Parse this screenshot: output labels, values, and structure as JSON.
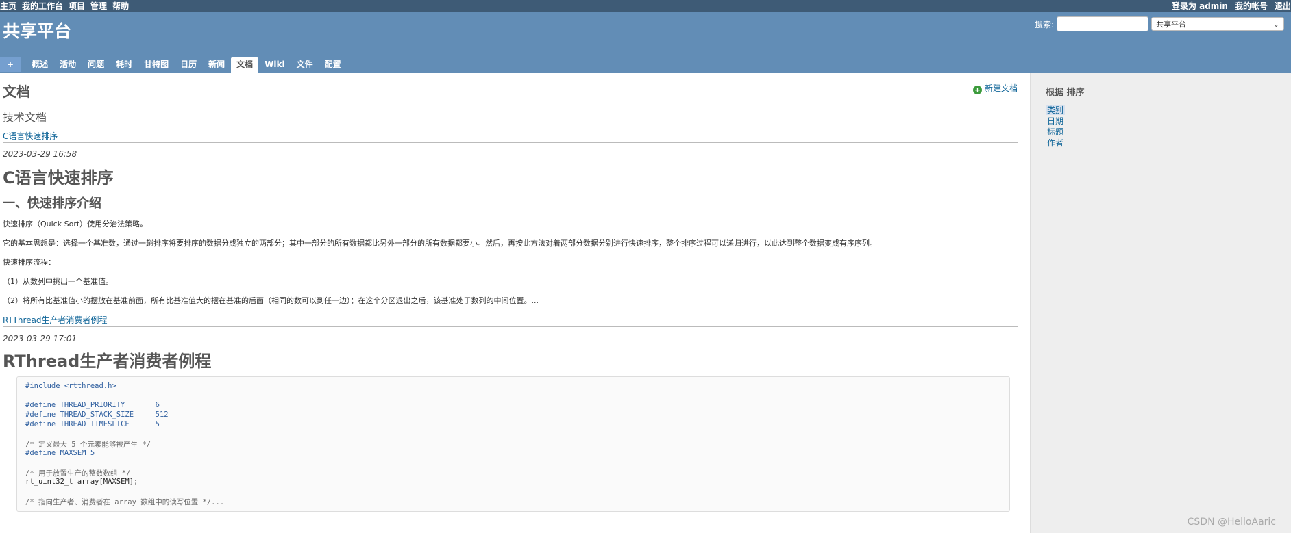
{
  "top_menu": {
    "left": [
      "主页",
      "我的工作台",
      "项目",
      "管理",
      "帮助"
    ],
    "logged_in_as": "登录为 admin",
    "my_account": "我的帐号",
    "logout": "退出"
  },
  "header": {
    "project_title": "共享平台",
    "search_label": "搜索:",
    "search_placeholder": "",
    "project_jump_value": "共享平台"
  },
  "main_menu": {
    "plus": "+",
    "tabs": [
      "概述",
      "活动",
      "问题",
      "耗时",
      "甘特图",
      "日历",
      "新闻",
      "文档",
      "Wiki",
      "文件",
      "配置"
    ],
    "selected": "文档"
  },
  "content": {
    "page_title": "文档",
    "new_document": "新建文档",
    "category": "技术文档",
    "documents": [
      {
        "link": "C语言快速排序",
        "date": "2023-03-29 16:58",
        "title": "C语言快速排序",
        "heading": "一、快速排序介绍",
        "paragraphs": [
          "快速排序（Quick Sort）使用分治法策略。",
          "它的基本思想是：选择一个基准数，通过一趟排序将要排序的数据分成独立的两部分；其中一部分的所有数据都比另外一部分的所有数据都要小。然后，再按此方法对着两部分数据分别进行快速排序，整个排序过程可以递归进行，以此达到整个数据变成有序序列。",
          "快速排序流程：",
          "（1）从数列中挑出一个基准值。",
          "（2）将所有比基准值小的摆放在基准前面，所有比基准值大的摆在基准的后面（相同的数可以到任一边）；在这个分区退出之后，该基准处于数列的中间位置。..."
        ]
      },
      {
        "link": "RTThread生产者消费者例程",
        "date": "2023-03-29 17:01",
        "title": "RThread生产者消费者例程",
        "code_lines": [
          {
            "text": "#include <rtthread.h>",
            "kind": "pp"
          },
          {
            "text": "",
            "kind": "tx"
          },
          {
            "text": "#define THREAD_PRIORITY       6",
            "kind": "pp"
          },
          {
            "text": "#define THREAD_STACK_SIZE     512",
            "kind": "pp"
          },
          {
            "text": "#define THREAD_TIMESLICE      5",
            "kind": "pp"
          },
          {
            "text": "",
            "kind": "tx"
          },
          {
            "text": "/* 定义最大 5 个元素能够被产生 */",
            "kind": "cm"
          },
          {
            "text": "#define MAXSEM 5",
            "kind": "pp"
          },
          {
            "text": "",
            "kind": "tx"
          },
          {
            "text": "/* 用于放置生产的整数数组 */",
            "kind": "cm"
          },
          {
            "text": "rt_uint32_t array[MAXSEM];",
            "kind": "tx"
          },
          {
            "text": "",
            "kind": "tx"
          },
          {
            "text": "/* 指向生产者、消费者在 array 数组中的读写位置 */...",
            "kind": "cm"
          }
        ]
      }
    ]
  },
  "sidebar": {
    "title": "根据 排序",
    "options": [
      "类别",
      "日期",
      "标题",
      "作者"
    ],
    "selected": "类别"
  },
  "watermark": "CSDN @HelloAaric",
  "colors": {
    "top_menu_bg": "#3E5B76",
    "header_bg": "#628DB6",
    "link": "#1166AA",
    "sidebar_bg": "#EEEEEE"
  }
}
